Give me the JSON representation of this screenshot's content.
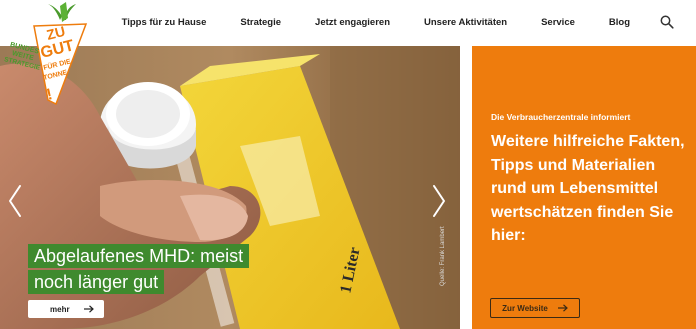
{
  "logo": {
    "line1": "BUNDES",
    "line2": "WEITE",
    "line3": "STRATEGIE",
    "main1": "ZU",
    "main2": "GUT",
    "sub1": "FÜR DIE",
    "sub2": "TONNE",
    "mark": "!",
    "colors": {
      "green": "#4a9a2c",
      "orange": "#ee7c0d"
    }
  },
  "nav": {
    "items": [
      "Tipps für zu Hause",
      "Strategie",
      "Jetzt engagieren",
      "Unsere Aktivitäten",
      "Service",
      "Blog"
    ],
    "search_icon": "search-icon"
  },
  "hero": {
    "caption_line1": "Abgelaufenes MHD: meist",
    "caption_line2": "noch länger gut",
    "more_label": "mehr",
    "credit": "Quelle: Frank Lambert",
    "carton_text": "1 Liter",
    "colors": {
      "caption_bg": "#3f8a2e"
    }
  },
  "panel": {
    "kicker": "Die Verbraucherzentrale informiert",
    "headline": "Weitere hilfreiche Fakten, Tipps und Materialien rund um Lebensmittel wertschätzen finden Sie hier:",
    "button_label": "Zur Website",
    "colors": {
      "bg": "#ee7c0d"
    }
  }
}
